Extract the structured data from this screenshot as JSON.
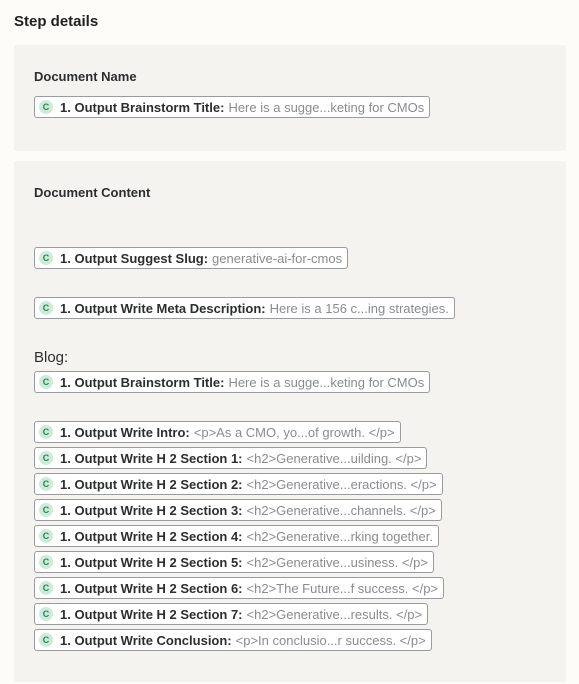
{
  "section_title": "Step details",
  "document_name": {
    "label": "Document Name",
    "pill": {
      "icon": "C",
      "label": "1. Output Brainstorm Title:",
      "value": "Here is a sugge...keting for CMOs"
    }
  },
  "document_content": {
    "label": "Document Content",
    "slug": {
      "icon": "C",
      "label": "1. Output Suggest Slug:",
      "value": "generative-ai-for-cmos"
    },
    "meta": {
      "icon": "C",
      "label": "1. Output Write Meta Description:",
      "value": "Here is a 156 c...ing strategies."
    },
    "blog_text": "Blog:",
    "blog_pills": [
      {
        "icon": "C",
        "label": "1. Output Brainstorm Title:",
        "value": "Here is a sugge...keting for CMOs"
      }
    ],
    "section_pills": [
      {
        "icon": "C",
        "label": "1. Output Write Intro:",
        "value": "<p>As a CMO, yo...of growth. </p>"
      },
      {
        "icon": "C",
        "label": "1. Output Write H 2 Section 1:",
        "value": "<h2>Generative...uilding.   </p>"
      },
      {
        "icon": "C",
        "label": "1. Output Write H 2 Section 2:",
        "value": "<h2>Generative...eractions. </p>"
      },
      {
        "icon": "C",
        "label": "1. Output Write H 2 Section 3:",
        "value": "<h2>Generative...channels. </p>"
      },
      {
        "icon": "C",
        "label": "1. Output Write H 2 Section 4:",
        "value": "<h2>Generative...rking together."
      },
      {
        "icon": "C",
        "label": "1. Output Write H 2 Section 5:",
        "value": "<h2>Generative...usiness.   </p>"
      },
      {
        "icon": "C",
        "label": "1. Output Write H 2 Section 6:",
        "value": "<h2>The Future...f success. </p>"
      },
      {
        "icon": "C",
        "label": "1. Output Write H 2 Section 7:",
        "value": "<h2>Generative...results.    </p>"
      },
      {
        "icon": "C",
        "label": "1. Output Write Conclusion:",
        "value": "<p>In conclusio...r success. </p>"
      }
    ]
  },
  "colors": {
    "panel_bg": "#f4f3f0",
    "pill_border": "#9a9b9e",
    "icon_bg": "#cfeadb",
    "icon_fg": "#1e8a56"
  }
}
